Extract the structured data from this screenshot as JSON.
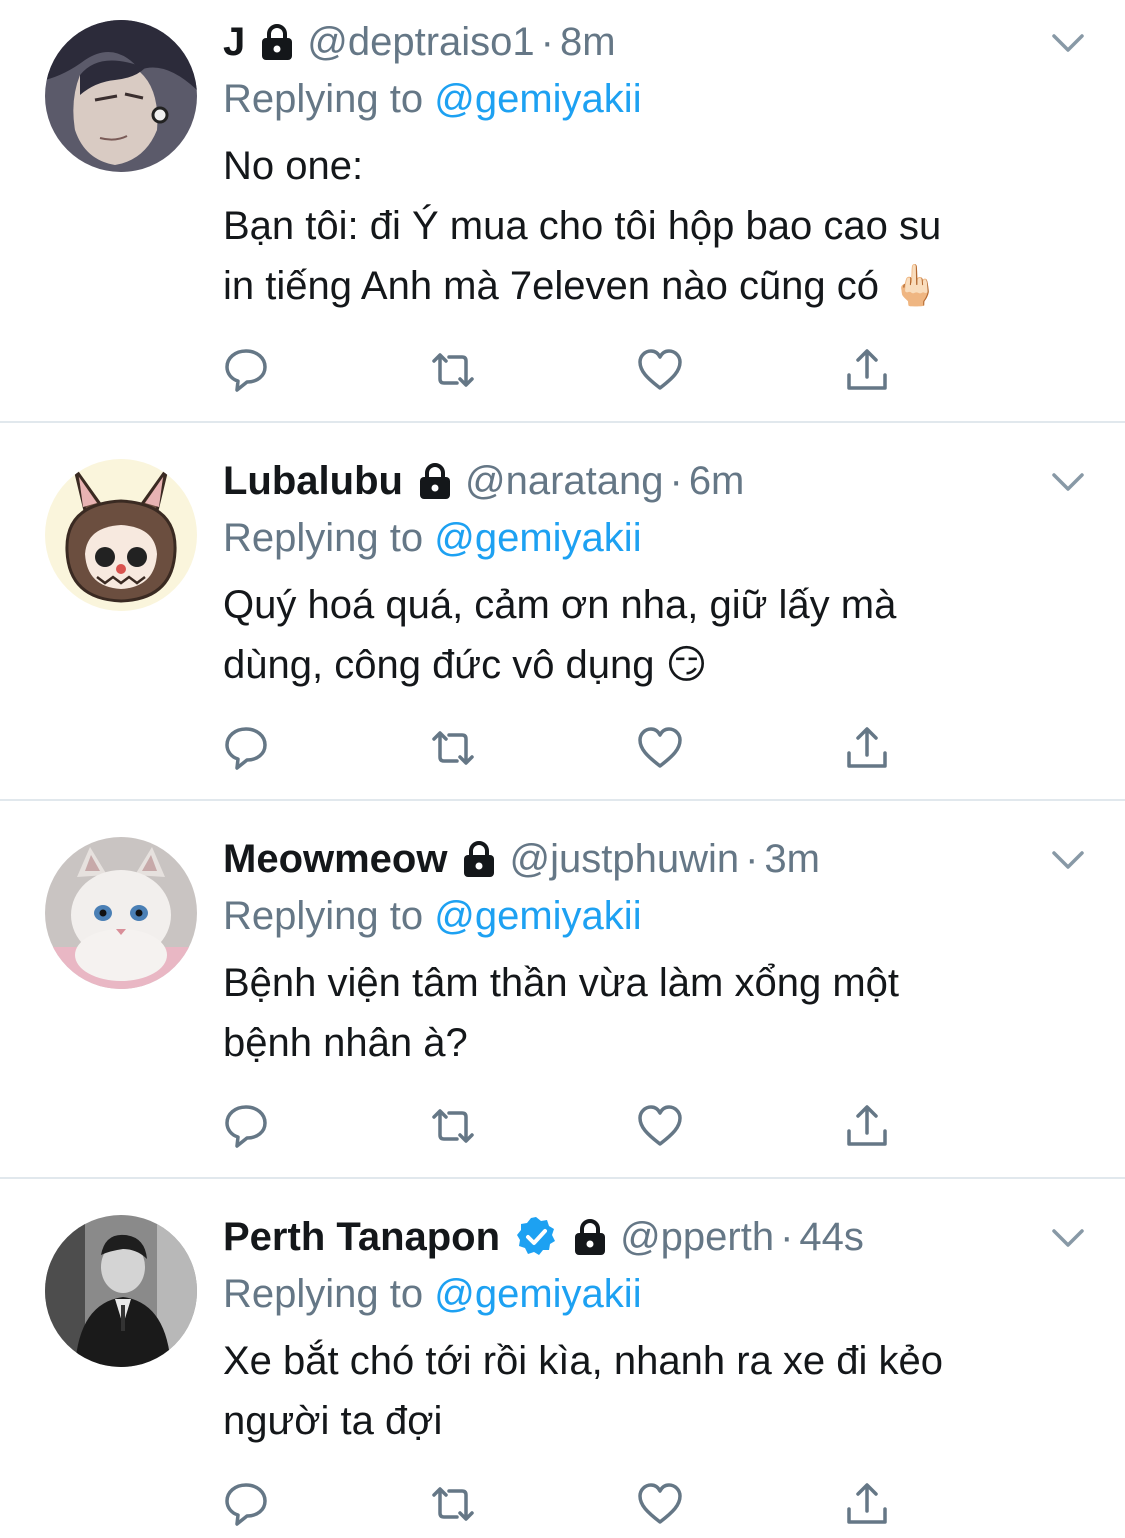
{
  "tweets": [
    {
      "name": "J",
      "handle": "@deptraiso1",
      "time": "8m",
      "verified": false,
      "reply_prefix": "Replying to",
      "reply_to": "@gemiyakii",
      "text": "No one:\nBạn tôi: đi Ý mua cho tôi hộp bao cao su\nin tiếng Anh mà 7eleven nào cũng có 🖕🏻"
    },
    {
      "name": "Lubalubu",
      "handle": "@naratang",
      "time": "6m",
      "verified": false,
      "reply_prefix": "Replying to",
      "reply_to": "@gemiyakii",
      "text": "Quý hoá quá, cảm ơn nha, giữ lấy mà\ndùng, công đức vô dụng 😏"
    },
    {
      "name": "Meowmeow",
      "handle": "@justphuwin",
      "time": "3m",
      "verified": false,
      "reply_prefix": "Replying to",
      "reply_to": "@gemiyakii",
      "text": "Bệnh viện tâm thần vừa làm xổng một\nbệnh nhân à?"
    },
    {
      "name": "Perth Tanapon",
      "handle": "@pperth",
      "time": "44s",
      "verified": true,
      "reply_prefix": "Replying to",
      "reply_to": "@gemiyakii",
      "text": "Xe bắt chó tới rồi kìa, nhanh ra xe đi kẻo\nngười ta đợi"
    }
  ],
  "separator": "·",
  "icons": {
    "lock": "lock-icon",
    "verified": "verified-badge-icon",
    "menu": "chevron-down-icon",
    "reply": "reply-icon",
    "retweet": "retweet-icon",
    "like": "heart-icon",
    "share": "share-icon"
  },
  "colors": {
    "link": "#1da1f2",
    "secondary": "#657786",
    "text": "#14171a",
    "divider": "#e1e8ed"
  }
}
